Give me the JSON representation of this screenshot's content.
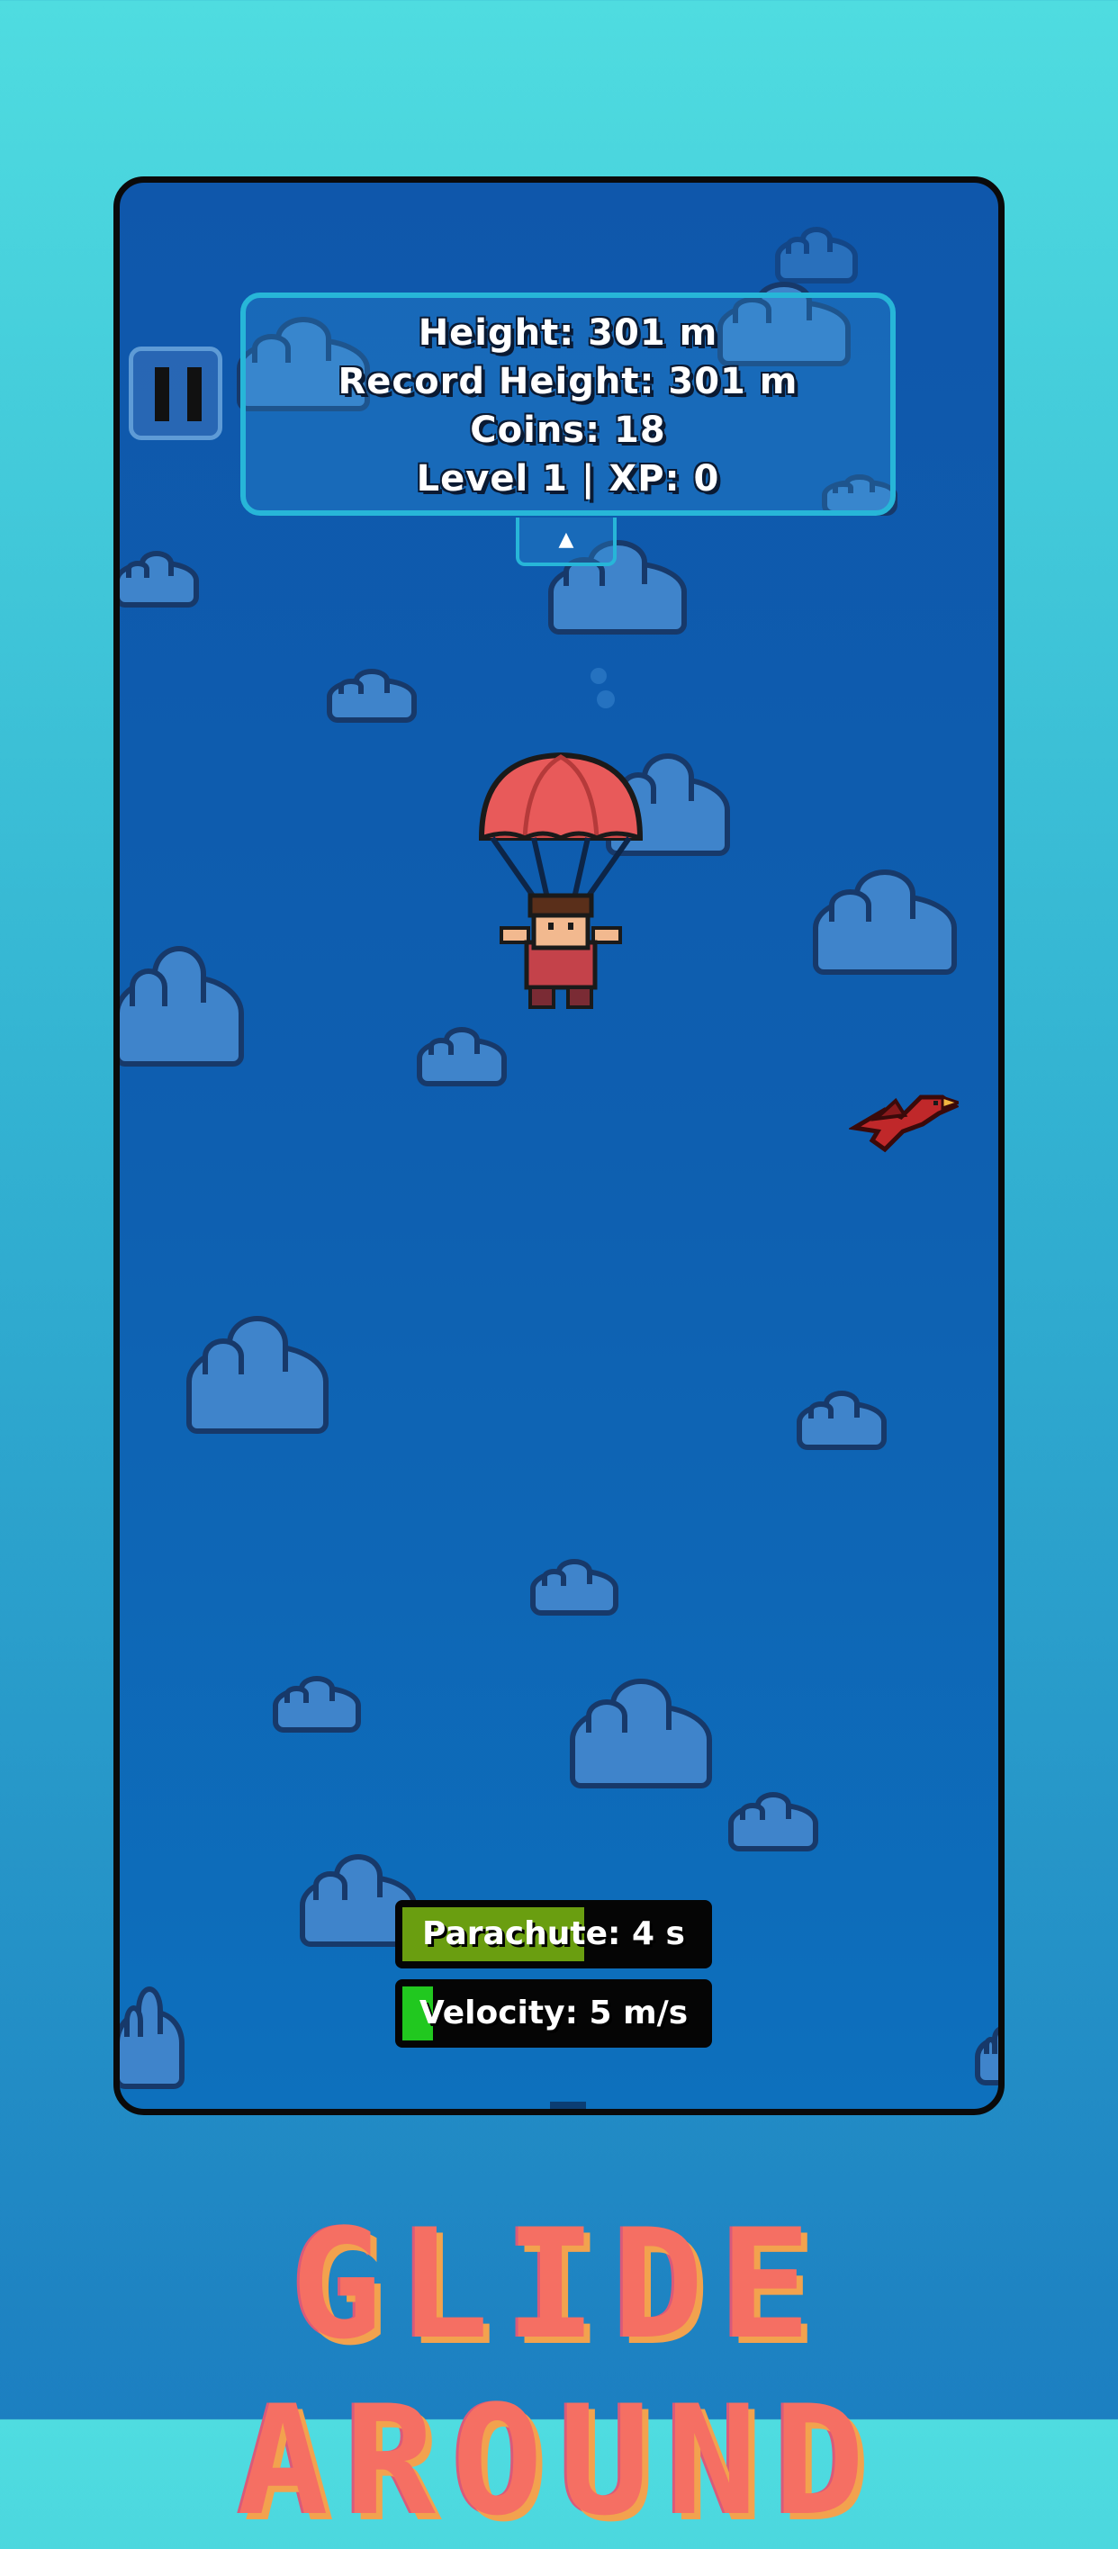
{
  "hud": {
    "height": "Height: 301 m",
    "record_height": "Record Height: 301 m",
    "coins": "Coins: 18",
    "level_xp": "Level 1 |  XP: 0"
  },
  "hud_toggle": {
    "icon": "chevron-up-icon",
    "glyph": "▲"
  },
  "pause_button": {
    "icon": "pause-icon"
  },
  "parachute_bar": {
    "label": "Parachute: 4 s",
    "fill": 0.6,
    "color": "#6a9e10"
  },
  "velocity_bar": {
    "label": "Velocity: 5 m/s",
    "fill": 0.1,
    "color": "#21c81f"
  },
  "title_banner": "GLIDE AROUND",
  "colors": {
    "sky": "#0e5fb0",
    "cloud": "#3f84cb",
    "hud_border": "#27b6d8",
    "title": "#f56f63",
    "parachute_canopy": "#e85a5a",
    "bird": "#c0282a"
  }
}
